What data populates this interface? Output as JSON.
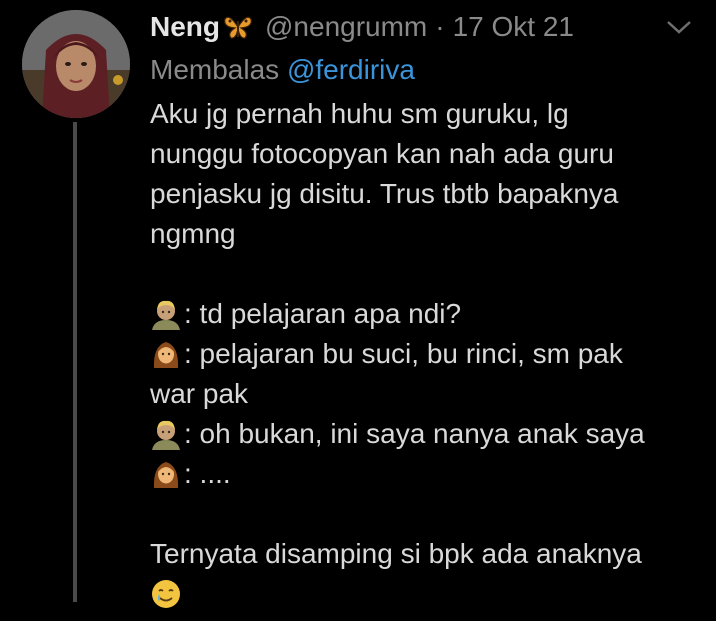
{
  "tweet": {
    "author_name": "Neng",
    "author_emoji": "butterfly-icon",
    "handle": "@nengrumm",
    "separator": "·",
    "date": "17 Okt 21",
    "reply_prefix": "Membalas",
    "reply_mention": "@ferdiriva",
    "text_lines": [
      "Aku jg pernah huhu sm guruku, lg",
      "nunggu fotocopyan kan nah ada guru",
      "penjasku jg disitu. Trus tbtb bapaknya",
      "ngmng"
    ],
    "dialogue": [
      {
        "speaker_icon": "man-blond-emoji",
        "text": ": td pelajaran apa ndi?"
      },
      {
        "speaker_icon": "woman-emoji",
        "text": ": pelajaran bu suci, bu rinci, sm pak"
      },
      {
        "speaker_icon": "",
        "text": "war pak"
      },
      {
        "speaker_icon": "man-blond-emoji",
        "text": ": oh bukan, ini saya nanya anak saya"
      },
      {
        "speaker_icon": "woman-emoji",
        "text": ":  ...."
      }
    ],
    "closing_line": "Ternyata disamping si bpk ada anaknya",
    "closing_emoji": "smiling-face-with-tear-emoji"
  },
  "colors": {
    "background": "#000000",
    "text": "#d9d9d9",
    "muted": "#8a8a8a",
    "link": "#3b94d9",
    "thread_line": "#4a4a4a"
  }
}
